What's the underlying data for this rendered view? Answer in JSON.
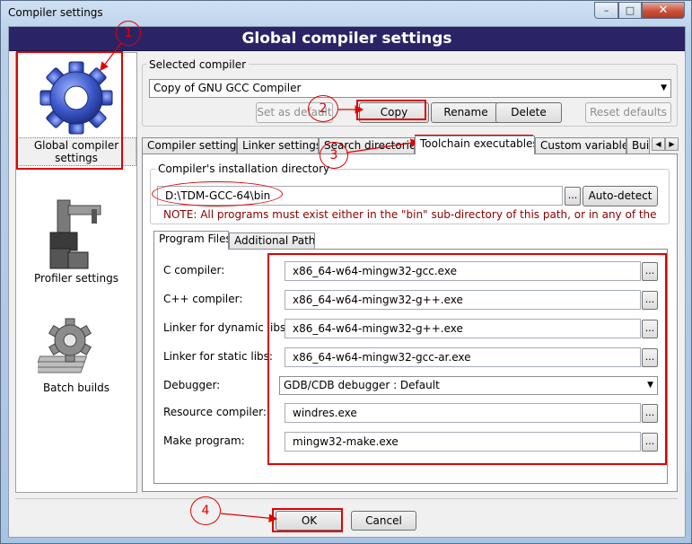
{
  "window": {
    "title": "Compiler settings",
    "close_glyph": "✕",
    "min_glyph": "–",
    "max_glyph": "□"
  },
  "header": {
    "title": "Global compiler settings"
  },
  "sidebar": {
    "items": [
      {
        "label": "Global compiler settings",
        "icon": "gear-icon",
        "selected": true
      },
      {
        "label": "Profiler settings",
        "icon": "profiler-icon"
      },
      {
        "label": "Batch builds",
        "icon": "batch-builds-icon"
      }
    ]
  },
  "selected_compiler": {
    "legend": "Selected compiler",
    "value": "Copy of GNU GCC Compiler",
    "buttons": {
      "set_default": "Set as default",
      "copy": "Copy",
      "rename": "Rename",
      "delete": "Delete",
      "reset": "Reset defaults"
    }
  },
  "tabs": [
    "Compiler settings",
    "Linker settings",
    "Search directories",
    "Toolchain executables",
    "Custom variables",
    "Bui"
  ],
  "active_tab": "Toolchain executables",
  "install_dir": {
    "legend": "Compiler's installation directory",
    "value": "D:\\TDM-GCC-64\\bin",
    "browse": "...",
    "autodetect": "Auto-detect",
    "note": "NOTE: All programs must exist either in the \"bin\" sub-directory of this path, or in any of the"
  },
  "subtabs": [
    "Program Files",
    "Additional Paths"
  ],
  "programs": [
    {
      "label": "C compiler:",
      "value": "x86_64-w64-mingw32-gcc.exe"
    },
    {
      "label": "C++ compiler:",
      "value": "x86_64-w64-mingw32-g++.exe"
    },
    {
      "label": "Linker for dynamic libs:",
      "value": "x86_64-w64-mingw32-g++.exe"
    },
    {
      "label": "Linker for static libs:",
      "value": "x86_64-w64-mingw32-gcc-ar.exe"
    },
    {
      "label": "Debugger:",
      "value": "GDB/CDB debugger : Default"
    },
    {
      "label": "Resource compiler:",
      "value": "windres.exe"
    },
    {
      "label": "Make program:",
      "value": "mingw32-make.exe"
    }
  ],
  "browse_label": "...",
  "footer": {
    "ok": "OK",
    "cancel": "Cancel"
  },
  "annotations": [
    "1",
    "2",
    "3",
    "4"
  ],
  "colors": {
    "header_bg": "#2a2466",
    "annotation_red": "#e00000",
    "note_text": "#8b0000"
  }
}
